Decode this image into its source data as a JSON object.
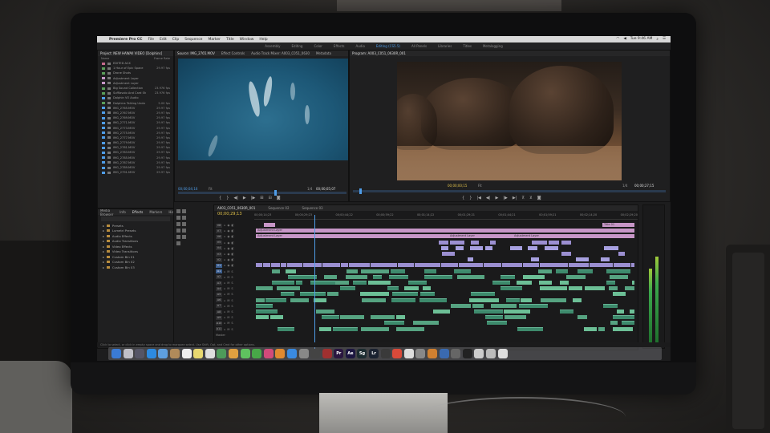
{
  "menubar": {
    "app": "Premiere Pro CC",
    "items": [
      "File",
      "Edit",
      "Clip",
      "Sequence",
      "Marker",
      "Title",
      "Window",
      "Help"
    ],
    "clock": "Tue 9:46 AM"
  },
  "workspaces": {
    "tabs": [
      "Assembly",
      "Editing",
      "Color",
      "Effects",
      "Audio",
      "Editing (CS5.5)",
      "All Panels",
      "Libraries",
      "Titles",
      "Metalogging"
    ],
    "active_index": 5
  },
  "project": {
    "title": "Project: NEW HAWAII VIDEO [Dolphins]",
    "tabs": [
      "Media Browser",
      "Info",
      "Effects",
      "Markers",
      "History"
    ],
    "column_rate": "Frame Rate",
    "items": [
      {
        "name": "EDITED ACX",
        "rate": "",
        "color": "#c66a8c"
      },
      {
        "name": "1 Hour of Epic Space",
        "rate": "29.97 fps",
        "color": "#5a9e5a"
      },
      {
        "name": "Drone Shots",
        "rate": "",
        "color": "#5a9e5a"
      },
      {
        "name": "Adjustment Layer",
        "rate": "",
        "color": "#c796c7"
      },
      {
        "name": "Adjustment Layer",
        "rate": "",
        "color": "#c796c7"
      },
      {
        "name": "Big Sound Collection",
        "rate": "23.976 fps",
        "color": "#5a9e5a"
      },
      {
        "name": "Sufflavolo And Card Sh",
        "rate": "23.976 fps",
        "color": "#5a9e5a"
      },
      {
        "name": "Dolphin VO Audio",
        "rate": "",
        "color": "#4f9de8"
      },
      {
        "name": "Dolphins Talking Undo",
        "rate": "5.00 fps",
        "color": "#5a9e5a"
      },
      {
        "name": "IMG_2765.MOV",
        "rate": "29.97 fps",
        "color": "#4f9de8"
      },
      {
        "name": "IMG_2767.MOV",
        "rate": "29.97 fps",
        "color": "#4f9de8"
      },
      {
        "name": "IMG_2769.MOV",
        "rate": "29.97 fps",
        "color": "#4f9de8"
      },
      {
        "name": "IMG_2771.MOV",
        "rate": "29.97 fps",
        "color": "#4f9de8"
      },
      {
        "name": "IMG_2773.MOV",
        "rate": "29.97 fps",
        "color": "#4f9de8"
      },
      {
        "name": "IMG_2775.MOV",
        "rate": "29.97 fps",
        "color": "#4f9de8"
      },
      {
        "name": "IMG_2777.MOV",
        "rate": "29.97 fps",
        "color": "#4f9de8"
      },
      {
        "name": "IMG_2779.MOV",
        "rate": "29.97 fps",
        "color": "#4f9de8"
      },
      {
        "name": "IMG_2781.MOV",
        "rate": "29.97 fps",
        "color": "#4f9de8"
      },
      {
        "name": "IMG_2783.MOV",
        "rate": "29.97 fps",
        "color": "#4f9de8"
      },
      {
        "name": "IMG_2785.MOV",
        "rate": "29.97 fps",
        "color": "#4f9de8"
      },
      {
        "name": "IMG_2787.MOV",
        "rate": "29.97 fps",
        "color": "#4f9de8"
      },
      {
        "name": "IMG_2789.MOV",
        "rate": "29.97 fps",
        "color": "#4f9de8"
      },
      {
        "name": "IMG_2791.MOV",
        "rate": "29.97 fps",
        "color": "#4f9de8"
      }
    ]
  },
  "source": {
    "tabs": [
      "Source: IMG_2765.MOV",
      "Effect Controls",
      "Audio Track Mixer: A003_C051_0630",
      "Metadata"
    ],
    "timecode": "00;00;04;16",
    "zoom": "Fit",
    "duration": "00;00;05;07",
    "res": "1/4"
  },
  "program": {
    "tab": "Program: A003_C051_0630R_001",
    "timecode": "00;00;00;15",
    "zoom": "Fit",
    "res": "1/4",
    "duration": "00;00;27;15"
  },
  "effects": {
    "items": [
      "Presets",
      "Lumetri Presets",
      "Audio Effects",
      "Audio Transitions",
      "Video Effects",
      "Video Transitions",
      "Custom Bin 01",
      "Custom Bin 02",
      "Custom Bin 03"
    ]
  },
  "timeline": {
    "tabs": [
      "A003_C051_0630R_001",
      "Sequence 02",
      "Sequence 03"
    ],
    "timecode": "00;00;29;13",
    "ruler": [
      "00;00;14;23",
      "00;00;29;23",
      "00;00;44;22",
      "00;00;59;22",
      "00;01;14;22",
      "00;01;29;21",
      "00;01;44;21",
      "00;01;59;21",
      "00;02;14;20",
      "00;02;29;20"
    ],
    "video_tracks": [
      "V8",
      "V7",
      "V6",
      "V5",
      "V4",
      "V3",
      "V2",
      "V1"
    ],
    "audio_tracks": [
      "A1",
      "A2",
      "A3",
      "A4",
      "A5",
      "A6",
      "A7",
      "A8",
      "A9",
      "A10",
      "A11"
    ],
    "clip_labels": {
      "adj1": "Adjustment Layer",
      "adj2": "Adjustment Layer",
      "adj3": "Adjustment Layer",
      "adj4": "Adjustment Layer",
      "title": "Title 01"
    },
    "master": "Master"
  },
  "status": "Click to select, or click in empty space and drag to marquee select. Use Shift, Opt, and Cmd for other options.",
  "dock": [
    {
      "name": "finder-icon",
      "glyph": "",
      "color": "#3a7bd5"
    },
    {
      "name": "launchpad-icon",
      "glyph": "",
      "color": "#c0c0c8"
    },
    {
      "name": "mission-control-icon",
      "glyph": "",
      "color": "#556"
    },
    {
      "name": "safari-icon",
      "glyph": "",
      "color": "#2d8ae0"
    },
    {
      "name": "mail-icon",
      "glyph": "",
      "color": "#5e9fe0"
    },
    {
      "name": "contacts-icon",
      "glyph": "",
      "color": "#b08a5a"
    },
    {
      "name": "calendar-icon",
      "glyph": "",
      "color": "#eee"
    },
    {
      "name": "notes-icon",
      "glyph": "",
      "color": "#e8d870"
    },
    {
      "name": "reminders-icon",
      "glyph": "",
      "color": "#ddd"
    },
    {
      "name": "maps-icon",
      "glyph": "",
      "color": "#4e9a5a"
    },
    {
      "name": "photos-icon",
      "glyph": "",
      "color": "#e0a040"
    },
    {
      "name": "messages-icon",
      "glyph": "",
      "color": "#5fc25f"
    },
    {
      "name": "facetime-icon",
      "glyph": "",
      "color": "#48a848"
    },
    {
      "name": "itunes-icon",
      "glyph": "",
      "color": "#d24a7a"
    },
    {
      "name": "ibooks-icon",
      "glyph": "",
      "color": "#e08a30"
    },
    {
      "name": "app-store-icon",
      "glyph": "",
      "color": "#3a8ae0"
    },
    {
      "name": "preview-icon",
      "glyph": "",
      "color": "#888"
    },
    {
      "name": "dvd-player-icon",
      "glyph": "",
      "color": "#444"
    },
    {
      "name": "photo-booth-icon",
      "glyph": "",
      "color": "#a03030"
    },
    {
      "name": "premiere-pro-icon",
      "glyph": "Pr",
      "color": "#2a1640"
    },
    {
      "name": "after-effects-icon",
      "glyph": "Ae",
      "color": "#1c1640"
    },
    {
      "name": "speedgrade-icon",
      "glyph": "Sg",
      "color": "#1c2c30"
    },
    {
      "name": "lightroom-icon",
      "glyph": "Lr",
      "color": "#1a2230"
    },
    {
      "name": "creative-cloud-icon",
      "glyph": "",
      "color": "#3a3a3a"
    },
    {
      "name": "chrome-icon",
      "glyph": "",
      "color": "#d94a3a"
    },
    {
      "name": "itunes-2-icon",
      "glyph": "",
      "color": "#ddd"
    },
    {
      "name": "system-preferences-icon",
      "glyph": "",
      "color": "#888"
    },
    {
      "name": "sublime-icon",
      "glyph": "",
      "color": "#d08030"
    },
    {
      "name": "xcode-icon",
      "glyph": "",
      "color": "#3a6ab0"
    },
    {
      "name": "activity-monitor-icon",
      "glyph": "",
      "color": "#666"
    },
    {
      "name": "terminal-icon",
      "glyph": "",
      "color": "#222"
    },
    {
      "name": "downloads-icon",
      "glyph": "",
      "color": "#ccc"
    },
    {
      "name": "documents-icon",
      "glyph": "",
      "color": "#bbb"
    },
    {
      "name": "trash-icon",
      "glyph": "",
      "color": "#ddd"
    }
  ]
}
